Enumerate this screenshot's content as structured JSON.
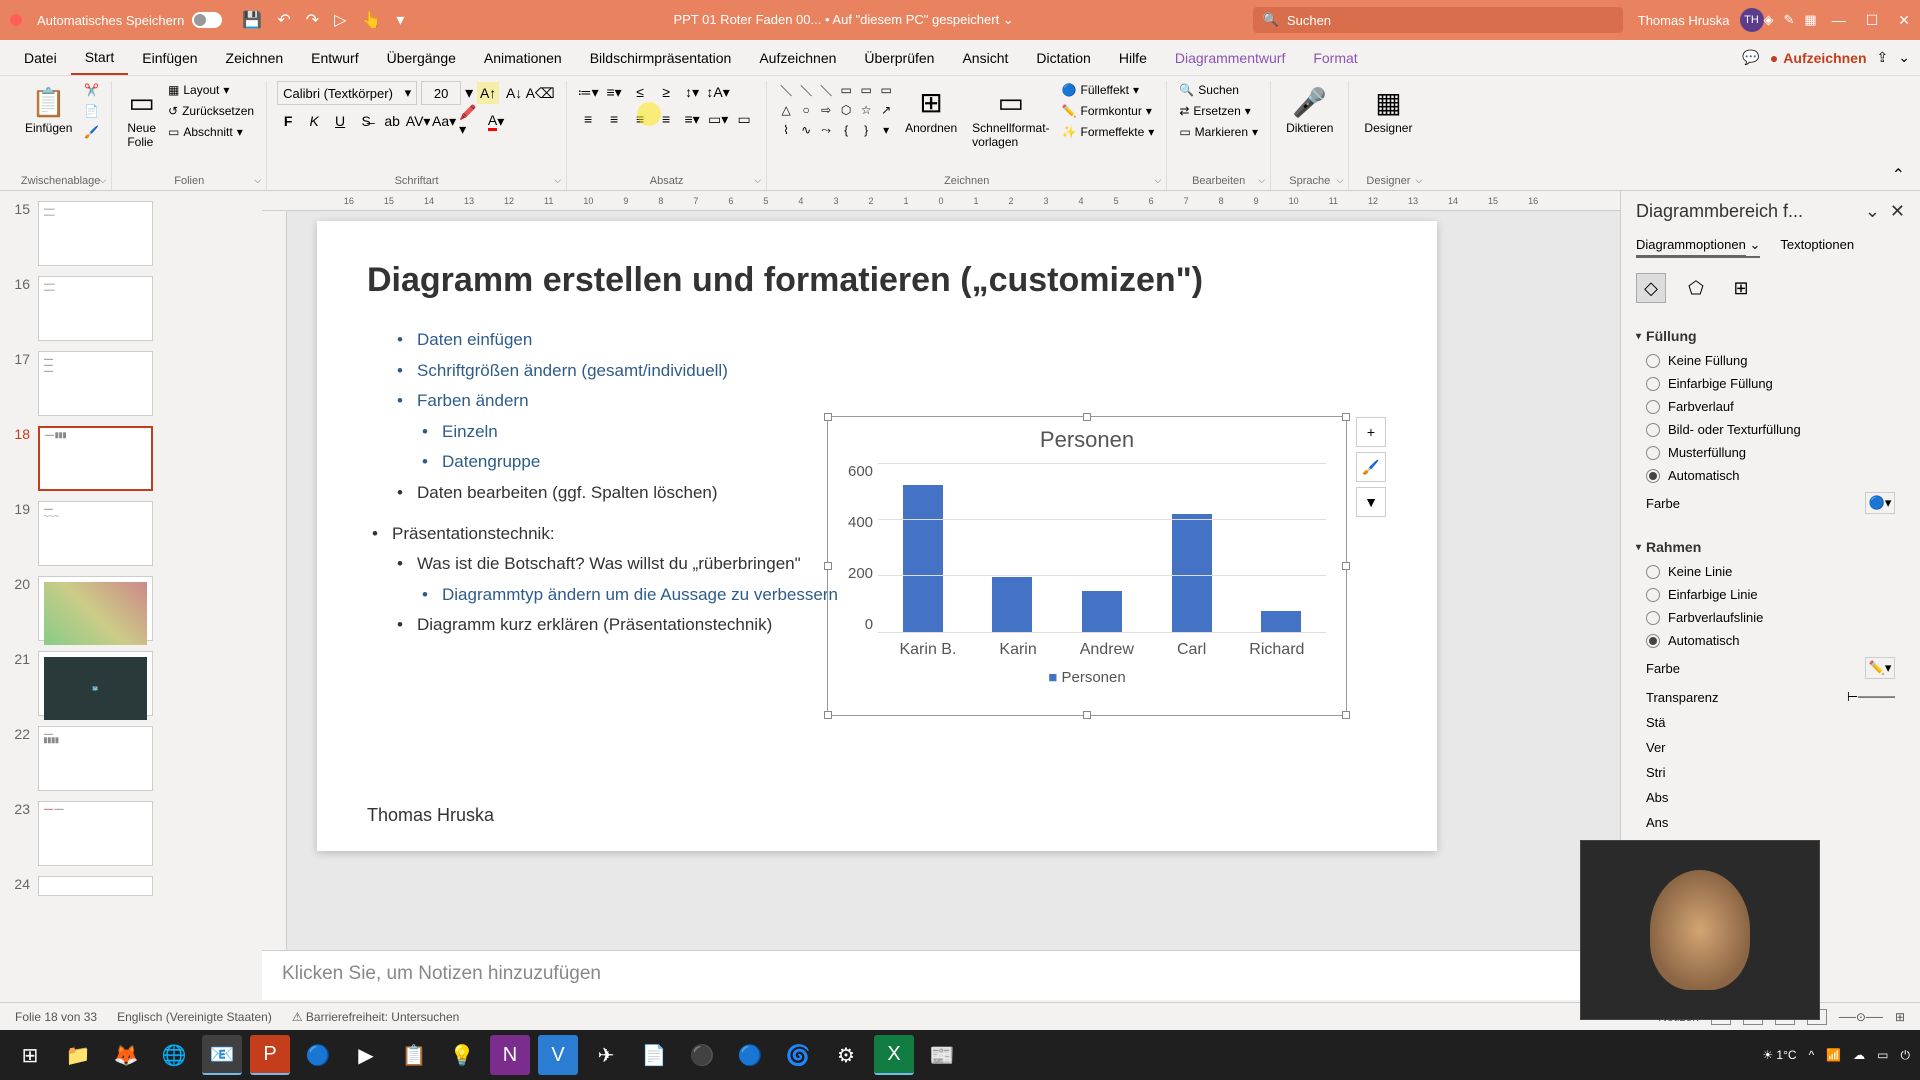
{
  "titlebar": {
    "autosave": "Automatisches Speichern",
    "filename": "PPT 01 Roter Faden 00...",
    "saved_location": "• Auf \"diesem PC\" gespeichert",
    "search_placeholder": "Suchen",
    "user": "Thomas Hruska",
    "user_initials": "TH"
  },
  "tabs": {
    "datei": "Datei",
    "start": "Start",
    "einfuegen": "Einfügen",
    "zeichnen": "Zeichnen",
    "entwurf": "Entwurf",
    "uebergaenge": "Übergänge",
    "animationen": "Animationen",
    "bildschirm": "Bildschirmpräsentation",
    "aufzeichnen": "Aufzeichnen",
    "ueberpruefen": "Überprüfen",
    "ansicht": "Ansicht",
    "dictation": "Dictation",
    "hilfe": "Hilfe",
    "diagrammentwurf": "Diagrammentwurf",
    "format": "Format",
    "aufzeichnen_btn": "Aufzeichnen"
  },
  "ribbon": {
    "einfuegen": "Einfügen",
    "neue_folie": "Neue\nFolie",
    "layout": "Layout",
    "zuruecksetzen": "Zurücksetzen",
    "abschnitt": "Abschnitt",
    "zwischenablage": "Zwischenablage",
    "folien": "Folien",
    "font_name": "Calibri (Textkörper)",
    "font_size": "20",
    "schriftart": "Schriftart",
    "absatz": "Absatz",
    "anordnen": "Anordnen",
    "schnellformat": "Schnellformat-\nvorlagen",
    "fuelleffekt": "Fülleffekt",
    "formkontur": "Formkontur",
    "formeffekte": "Formeffekte",
    "zeichnen_grp": "Zeichnen",
    "suchen": "Suchen",
    "ersetzen": "Ersetzen",
    "markieren": "Markieren",
    "bearbeiten": "Bearbeiten",
    "diktieren": "Diktieren",
    "sprache": "Sprache",
    "designer": "Designer",
    "designer_grp": "Designer"
  },
  "slides": {
    "visible": [
      "15",
      "16",
      "17",
      "18",
      "19",
      "20",
      "21",
      "22",
      "23",
      "24"
    ],
    "active": "18"
  },
  "slide_content": {
    "title": "Diagramm erstellen und formatieren („customizen\")",
    "b1": "Daten einfügen",
    "b2": "Schriftgrößen ändern (gesamt/individuell)",
    "b3": "Farben ändern",
    "b3a": "Einzeln",
    "b3b": "Datengruppe",
    "b4": "Daten bearbeiten (ggf. Spalten löschen)",
    "b5": "Präsentationstechnik:",
    "b5a": "Was ist die Botschaft? Was willst du „rüberbringen\"",
    "b5a1": "Diagrammtyp ändern um die Aussage zu verbessern",
    "b5b": "Diagramm kurz erklären (Präsentationstechnik)",
    "footer": "Thomas Hruska"
  },
  "chart_data": {
    "type": "bar",
    "title": "Personen",
    "categories": [
      "Karin B.",
      "Karin",
      "Andrew",
      "Carl",
      "Richard"
    ],
    "values": [
      520,
      200,
      150,
      420,
      80
    ],
    "ylabel": "",
    "ylim": [
      0,
      600
    ],
    "yticks": [
      0,
      200,
      400,
      600
    ],
    "legend": "Personen"
  },
  "format_pane": {
    "title": "Diagrammbereich f...",
    "tab1": "Diagrammoptionen",
    "tab2": "Textoptionen",
    "sec_fill": "Füllung",
    "fill_none": "Keine Füllung",
    "fill_solid": "Einfarbige Füllung",
    "fill_gradient": "Farbverlauf",
    "fill_picture": "Bild- oder Texturfüllung",
    "fill_pattern": "Musterfüllung",
    "fill_auto": "Automatisch",
    "color": "Farbe",
    "sec_border": "Rahmen",
    "border_none": "Keine Linie",
    "border_solid": "Einfarbige Linie",
    "border_gradient": "Farbverlaufslinie",
    "border_auto": "Automatisch",
    "transparency": "Transparenz",
    "sta": "Stä",
    "ver": "Ver",
    "stri": "Stri",
    "abs": "Abs",
    "ans": "Ans"
  },
  "notes": {
    "placeholder": "Klicken Sie, um Notizen hinzuzufügen"
  },
  "statusbar": {
    "slide_info": "Folie 18 von 33",
    "language": "Englisch (Vereinigte Staaten)",
    "accessibility": "Barrierefreiheit: Untersuchen",
    "notizen": "Notizen"
  },
  "taskbar": {
    "weather": "1°C"
  }
}
